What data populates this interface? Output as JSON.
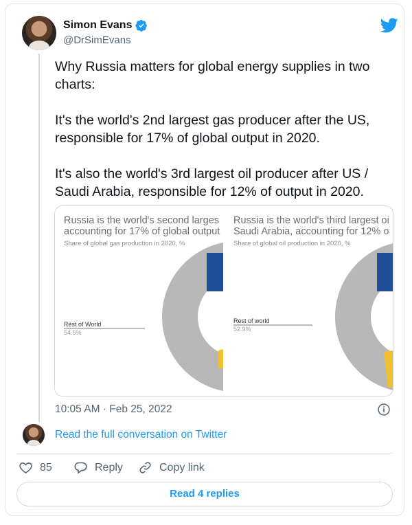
{
  "author": {
    "name": "Simon Evans",
    "handle": "@DrSimEvans"
  },
  "tweet": {
    "paragraphs": [
      "Why Russia matters for global energy supplies in two charts:",
      "It's the world's 2nd largest gas producer after the US, responsible for 17% of global output in 2020.",
      "It's also the world's 3rd largest oil producer after US / Saudi Arabia, responsible for 12% of output in 2020."
    ]
  },
  "media": {
    "left": {
      "title_line1": "Russia is the world's second larges",
      "title_line2": "accounting for 17% of global output",
      "subtitle": "Share of global gas production in 2020, %",
      "rest_label": "Rest of World",
      "rest_value": "54.5%"
    },
    "right": {
      "title_line1": "Russia is the world's third largest oi",
      "title_line2": "Saudi Arabia, accounting for 12% o",
      "subtitle": "Share of global oil production in 2020, %",
      "rest_label": "Rest of world",
      "rest_value": "52.9%"
    }
  },
  "chart_data": [
    {
      "type": "pie",
      "title": "Russia is the world's second larges... accounting for 17% of global output",
      "subtitle": "Share of global gas production in 2020, %",
      "categories": [
        "Rest of World"
      ],
      "values": [
        54.5
      ],
      "visible_colors": {
        "rest": "#b8b8b8",
        "blue_segment": "#1f4e96",
        "yellow_segment": "#f0c030"
      }
    },
    {
      "type": "pie",
      "title": "Russia is the world's third largest oi... Saudi Arabia, accounting for 12% o",
      "subtitle": "Share of global oil production in 2020, %",
      "categories": [
        "Rest of world"
      ],
      "values": [
        52.9
      ],
      "visible_colors": {
        "rest": "#b8b8b8",
        "blue_segment": "#1f4e96",
        "yellow_segment": "#f0c030"
      }
    }
  ],
  "meta": {
    "timestamp": "10:05 AM · Feb 25, 2022",
    "read_conversation": "Read the full conversation on Twitter"
  },
  "actions": {
    "like_count": "85",
    "reply_label": "Reply",
    "copy_label": "Copy link",
    "read_replies": "Read 4 replies"
  },
  "icons": {
    "verified": "verified-badge-icon",
    "twitter": "twitter-bird-icon",
    "info": "info-icon",
    "like": "heart-icon",
    "reply": "speech-bubble-icon",
    "copy": "link-icon"
  },
  "colors": {
    "accent": "#1d9bf0",
    "text": "#0f1419",
    "muted": "#536471"
  }
}
